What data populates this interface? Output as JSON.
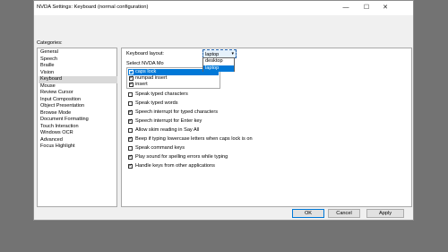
{
  "window": {
    "title": "NVDA Settings: Keyboard (normal configuration)",
    "minimize_glyph": "—",
    "maximize_glyph": "☐",
    "close_glyph": "✕"
  },
  "categories_label": "Categories:",
  "categories": [
    {
      "label": "General"
    },
    {
      "label": "Speech"
    },
    {
      "label": "Braille"
    },
    {
      "label": "Vision"
    },
    {
      "label": "Keyboard",
      "selected": true
    },
    {
      "label": "Mouse"
    },
    {
      "label": "Review Cursor"
    },
    {
      "label": "Input Composition"
    },
    {
      "label": "Object Presentation"
    },
    {
      "label": "Browse Mode"
    },
    {
      "label": "Document Formatting"
    },
    {
      "label": "Touch Interaction"
    },
    {
      "label": "Windows OCR"
    },
    {
      "label": "Advanced"
    },
    {
      "label": "Focus Highlight"
    }
  ],
  "keyboard": {
    "layout_label": "Keyboard layout:",
    "layout_value": "laptop",
    "layout_options": [
      {
        "label": "desktop"
      },
      {
        "label": "laptop",
        "selected": true
      }
    ],
    "modifier_label": "Select NVDA Mo",
    "modifier_keys": [
      {
        "label": "caps lock",
        "checked": true,
        "selected": true
      },
      {
        "label": "numpad insert",
        "checked": true
      },
      {
        "label": "insert",
        "checked": true
      }
    ],
    "options": [
      {
        "label": "Speak typed characters",
        "checked": false
      },
      {
        "label": "Speak typed words",
        "checked": false
      },
      {
        "label": "Speech interrupt for typed characters",
        "checked": true
      },
      {
        "label": "Speech interrupt for Enter key",
        "checked": true
      },
      {
        "label": "Allow skim reading in Say All",
        "checked": false
      },
      {
        "label": "Beep if typing lowercase letters when caps lock is on",
        "checked": true
      },
      {
        "label": "Speak command keys",
        "checked": false
      },
      {
        "label": "Play sound for spelling errors while typing",
        "checked": true
      },
      {
        "label": "Handle keys from other applications",
        "checked": true
      }
    ]
  },
  "buttons": {
    "ok": "OK",
    "cancel": "Cancel",
    "apply": "Apply"
  }
}
